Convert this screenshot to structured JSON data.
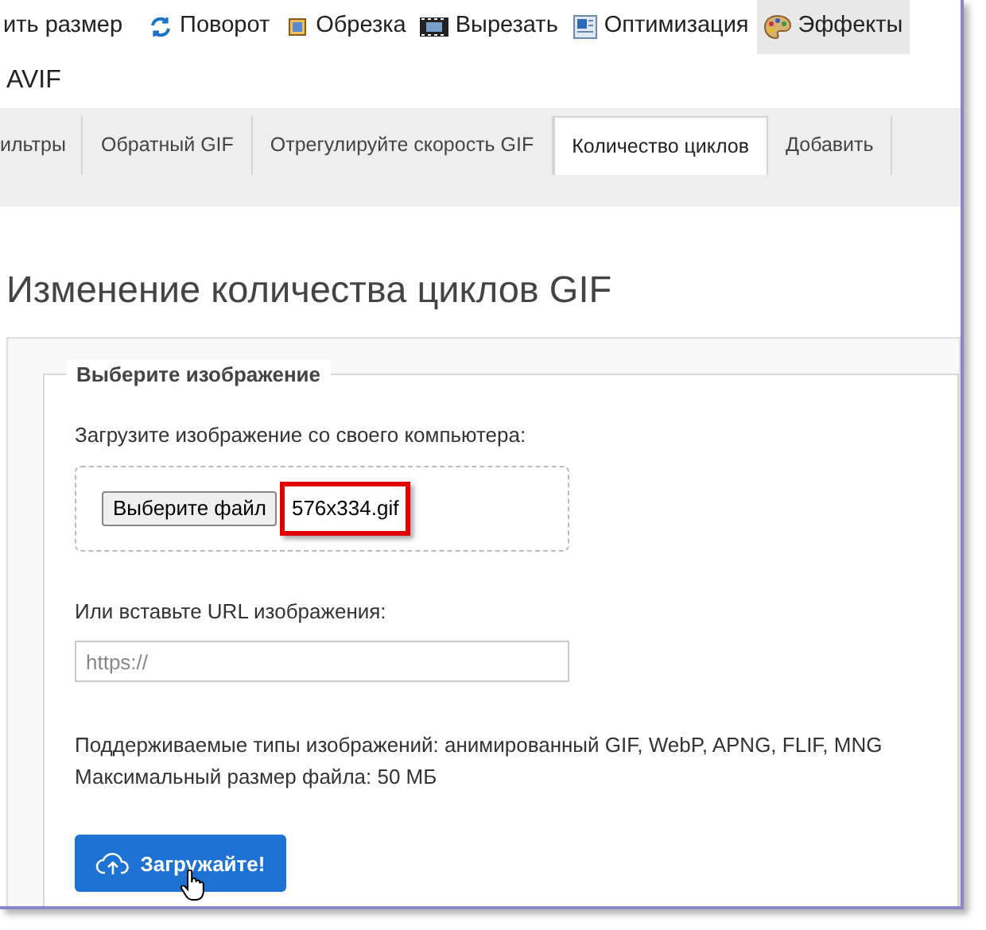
{
  "menu": [
    {
      "label": "ить размер",
      "selected": false
    },
    {
      "label": "Поворот",
      "selected": false
    },
    {
      "label": "Обрезка",
      "selected": false
    },
    {
      "label": "Вырезать",
      "selected": false
    },
    {
      "label": "Оптимизация",
      "selected": false
    },
    {
      "label": "Эффекты",
      "selected": true
    }
  ],
  "submenu": "AVIF",
  "tabs": [
    {
      "label": "ильтры",
      "selected": false
    },
    {
      "label": "Обратный GIF",
      "selected": false
    },
    {
      "label": "Отрегулируйте скорость GIF",
      "selected": false
    },
    {
      "label": "Количество циклов",
      "selected": true
    },
    {
      "label": "Добавить",
      "selected": false
    }
  ],
  "heading": "Изменение количества циклов GIF",
  "form": {
    "legend": "Выберите изображение",
    "upload_label": "Загрузите изображение со своего компьютера:",
    "file_button": "Выберите файл",
    "file_name": "576x334.gif",
    "file_name_highlighted": true,
    "url_label": "Или вставьте URL изображения:",
    "url_placeholder": "https://",
    "info": [
      "Поддерживаемые типы изображений: анимированный GIF, WebP, APNG, FLIF, MNG",
      "Максимальный размер файла: 50 МБ"
    ],
    "submit": "Загружайте!"
  }
}
